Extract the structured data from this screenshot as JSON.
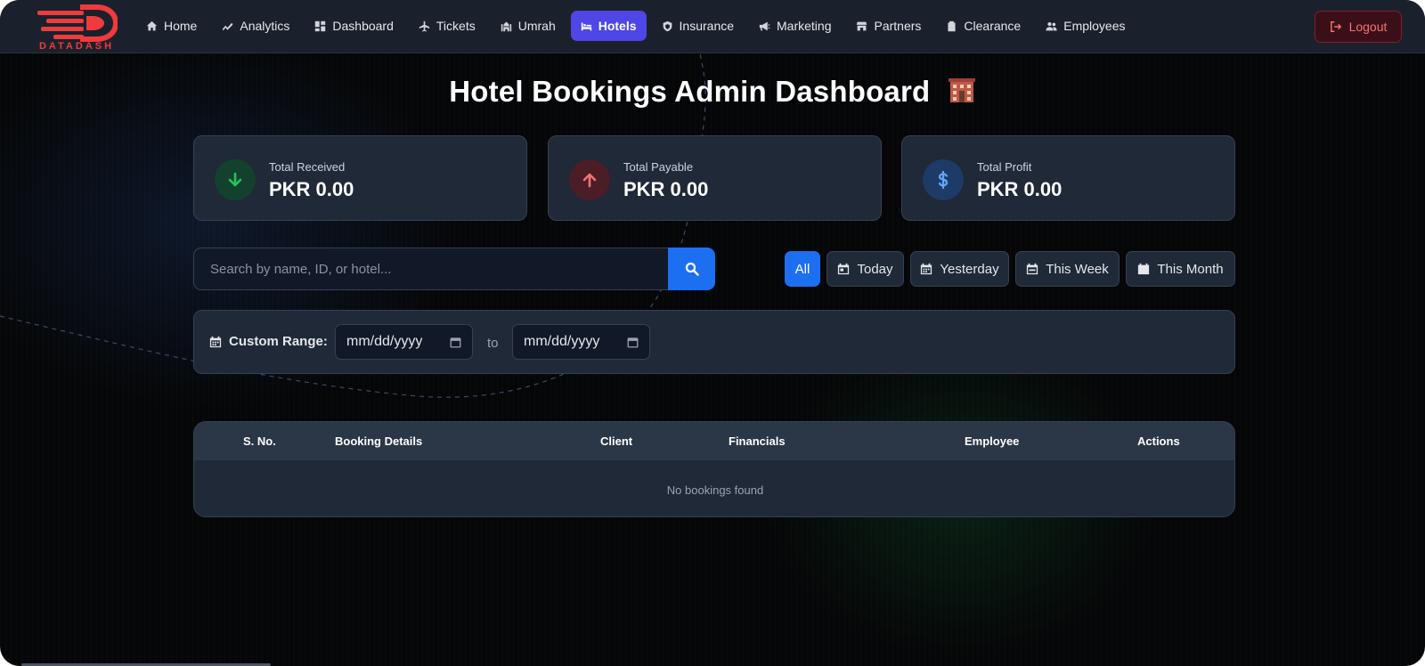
{
  "brand": {
    "name": "DATADASH",
    "color": "#ef3b3b"
  },
  "nav": {
    "items": [
      {
        "label": "Home",
        "icon": "home-icon"
      },
      {
        "label": "Analytics",
        "icon": "trend-icon"
      },
      {
        "label": "Dashboard",
        "icon": "grid-icon"
      },
      {
        "label": "Tickets",
        "icon": "plane-icon"
      },
      {
        "label": "Umrah",
        "icon": "mosque-icon"
      },
      {
        "label": "Hotels",
        "icon": "bed-icon",
        "active": true
      },
      {
        "label": "Insurance",
        "icon": "shield-icon"
      },
      {
        "label": "Marketing",
        "icon": "megaphone-icon"
      },
      {
        "label": "Partners",
        "icon": "store-icon"
      },
      {
        "label": "Clearance",
        "icon": "clipboard-icon"
      },
      {
        "label": "Employees",
        "icon": "users-icon"
      }
    ],
    "logout_label": "Logout",
    "active_color": "#4f46e5"
  },
  "page": {
    "title": "Hotel Bookings Admin Dashboard"
  },
  "stats": [
    {
      "label": "Total Received",
      "value": "PKR 0.00",
      "icon": "arrow-down-icon",
      "color": "#22c55e"
    },
    {
      "label": "Total Payable",
      "value": "PKR 0.00",
      "icon": "arrow-up-icon",
      "color": "#f87171"
    },
    {
      "label": "Total Profit",
      "value": "PKR 0.00",
      "icon": "dollar-icon",
      "color": "#60a5fa"
    }
  ],
  "search": {
    "placeholder": "Search by name, ID, or hotel...",
    "value": ""
  },
  "filters": [
    {
      "label": "All",
      "active": true
    },
    {
      "label": "Today",
      "icon": "calendar-day-icon"
    },
    {
      "label": "Yesterday",
      "icon": "calendar-icon"
    },
    {
      "label": "This Week",
      "icon": "calendar-week-icon"
    },
    {
      "label": "This Month",
      "icon": "calendar-month-icon"
    }
  ],
  "custom_range": {
    "label": "Custom Range:",
    "from_placeholder": "mm/dd/yyyy",
    "separator": "to",
    "to_placeholder": "mm/dd/yyyy"
  },
  "table": {
    "columns": [
      "S. No.",
      "Booking Details",
      "Client",
      "Financials",
      "Employee",
      "Actions"
    ],
    "empty_message": "No bookings found",
    "rows": []
  },
  "accent_color": "#1d6ff2"
}
